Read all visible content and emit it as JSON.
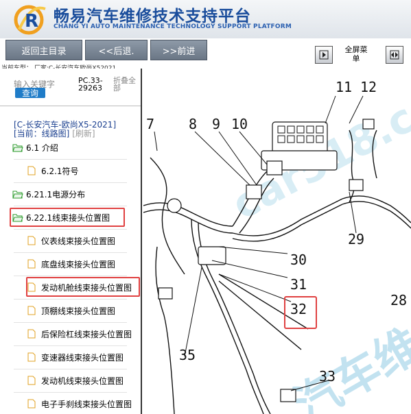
{
  "header": {
    "title_cn": "畅易汽车维修技术支持平台",
    "title_en": "CHANG YI AUTO MAINTENANCE TECHNOLOGY SUPPORT PLATFORM",
    "logo_letter": "R"
  },
  "toolbar": {
    "home_label": "返回主目录",
    "back_label": "<<后退.",
    "forward_label": ">>前进",
    "fullscreen_label": "全屏菜单"
  },
  "current_vehicle": "当前车型：  厂家:C-长安汽车欧尚X52021",
  "sidebar": {
    "search_hint": "输入关键字",
    "search_button": "查询",
    "pc_code": "PC.33-29263",
    "fold_all": "折叠全部",
    "vehicle": "[C-长安汽车-欧尚X5-2021]",
    "current_prefix": "[当前：线路图]",
    "refresh": "[刷新]",
    "items": [
      {
        "label": "6.1 介绍",
        "level": 1,
        "icon": "folder-open-icon"
      },
      {
        "label": "6.2.1符号",
        "level": 2,
        "icon": "document-icon"
      },
      {
        "label": "6.21.1电源分布",
        "level": 1,
        "icon": "folder-open-icon"
      },
      {
        "label": "6.22.1线束接头位置图",
        "level": 1,
        "icon": "folder-open-icon",
        "highlighted": true
      },
      {
        "label": "仪表线束接头位置图",
        "level": 2,
        "icon": "document-icon"
      },
      {
        "label": "底盘线束接头位置图",
        "level": 2,
        "icon": "document-icon"
      },
      {
        "label": "发动机舱线束接头位置图",
        "level": 2,
        "icon": "document-icon",
        "highlighted": true
      },
      {
        "label": "顶棚线束接头位置图",
        "level": 2,
        "icon": "document-icon"
      },
      {
        "label": "后保险杠线束接头位置图",
        "level": 2,
        "icon": "document-icon"
      },
      {
        "label": "变速器线束接头位置图",
        "level": 2,
        "icon": "document-icon"
      },
      {
        "label": "发动机线束接头位置图",
        "level": 2,
        "icon": "document-icon"
      },
      {
        "label": "电子手刹线束接头位置图",
        "level": 2,
        "icon": "document-icon"
      }
    ]
  },
  "diagram": {
    "callouts": [
      "7",
      "8",
      "9",
      "10",
      "11",
      "12",
      "29",
      "30",
      "31",
      "32",
      "28",
      "35",
      "33"
    ],
    "highlighted_callout": "32",
    "watermark": "car518.c",
    "watermark_cn": "汽车维"
  }
}
